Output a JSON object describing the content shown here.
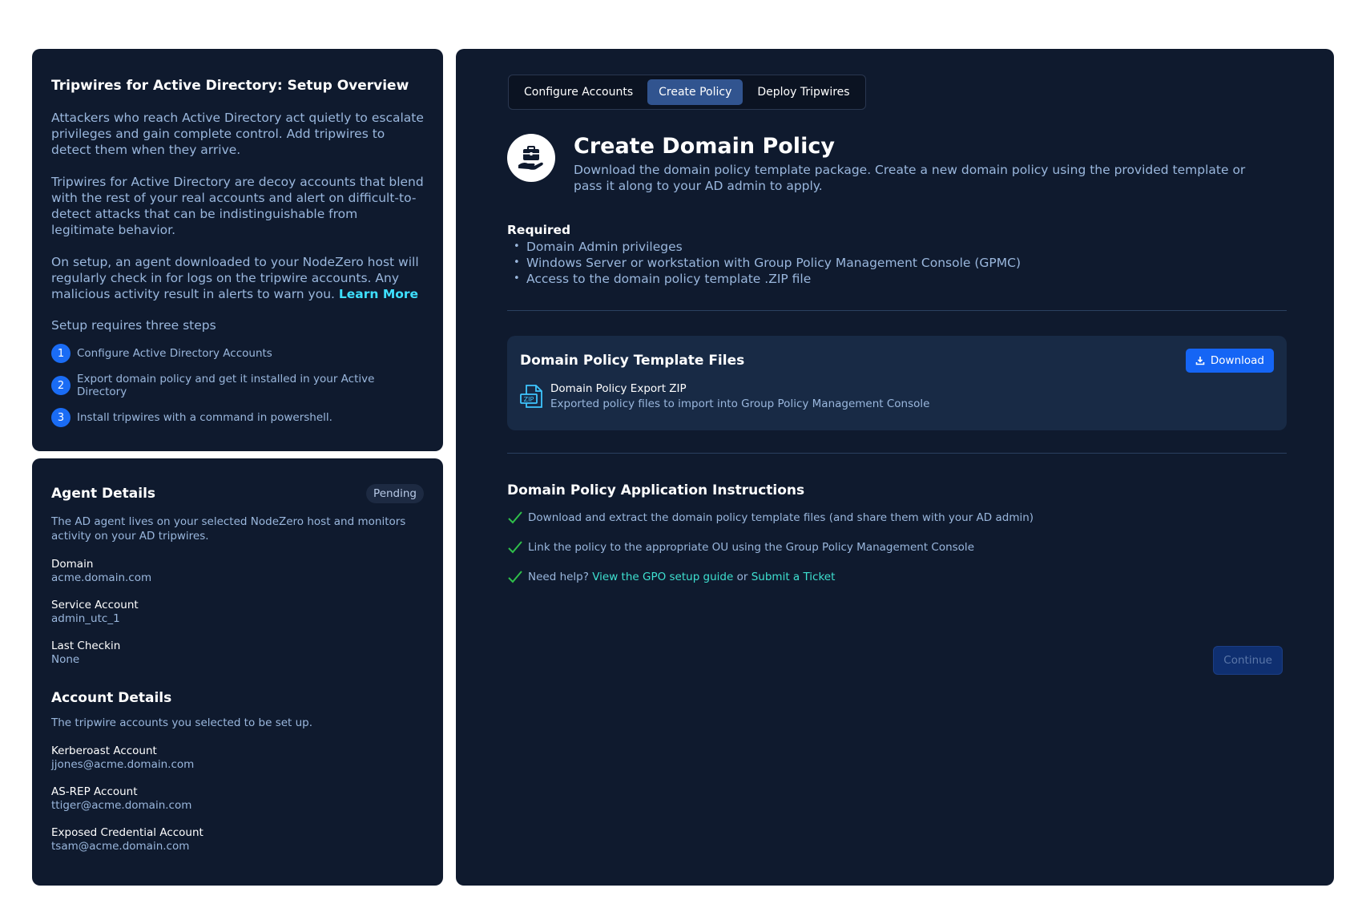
{
  "overview": {
    "title": "Tripwires for Active Directory: Setup Overview",
    "para1": "Attackers who reach Active Directory act quietly to escalate privileges and gain complete control. Add tripwires to detect them when they arrive.",
    "para2": "Tripwires for Active Directory are decoy accounts that blend with the rest of your real accounts and alert on difficult-to-detect attacks that can be indistinguishable from legitimate behavior.",
    "para3": "On setup, an agent downloaded to your NodeZero host will regularly check in for logs on the tripwire accounts. Any malicious activity result in alerts to warn you.",
    "learn_more": "Learn More",
    "steps_intro": "Setup requires three steps",
    "steps": [
      {
        "num": "1",
        "text": "Configure Active Directory Accounts"
      },
      {
        "num": "2",
        "text": "Export domain policy and get it installed in your Active Directory"
      },
      {
        "num": "3",
        "text": "Install tripwires with a command in powershell."
      }
    ]
  },
  "agent": {
    "title": "Agent Details",
    "status": "Pending",
    "desc": "The AD agent lives on your selected NodeZero host and monitors activity on your AD tripwires.",
    "fields": [
      {
        "label": "Domain",
        "value": "acme.domain.com"
      },
      {
        "label": "Service Account",
        "value": "admin_utc_1"
      },
      {
        "label": "Last Checkin",
        "value": "None"
      }
    ]
  },
  "accounts": {
    "title": "Account Details",
    "desc": "The tripwire accounts you selected to be set up.",
    "fields": [
      {
        "label": "Kerberoast Account",
        "value": "jjones@acme.domain.com"
      },
      {
        "label": "AS-REP Account",
        "value": "ttiger@acme.domain.com"
      },
      {
        "label": "Exposed Credential Account",
        "value": "tsam@acme.domain.com"
      }
    ]
  },
  "tabs": [
    {
      "label": "Configure Accounts",
      "active": false
    },
    {
      "label": "Create Policy",
      "active": true
    },
    {
      "label": "Deploy Tripwires",
      "active": false
    }
  ],
  "main": {
    "title": "Create Domain Policy",
    "desc": "Download the domain policy template package. Create a new domain policy using the provided template or pass it along to your AD admin to apply.",
    "required_title": "Required",
    "required": [
      "Domain Admin privileges",
      "Windows Server or workstation with Group Policy Management Console (GPMC)",
      "Access to the domain policy template .ZIP file"
    ],
    "files_title": "Domain Policy Template Files",
    "download_label": "Download",
    "file_name": "Domain Policy Export ZIP",
    "file_desc": "Exported policy files to import into Group Policy Management Console",
    "file_badge": "ZIP",
    "instr_title": "Domain Policy Application Instructions",
    "instr1": "Download and extract the domain policy template files (and share them with your AD admin)",
    "instr2": "Link the policy to the appropriate OU using the Group Policy Management Console",
    "help_prefix": "Need help?",
    "help_link1": "View the GPO setup guide",
    "help_or": "or",
    "help_link2": "Submit a Ticket",
    "continue_label": "Continue"
  },
  "colors": {
    "panel_bg": "#0f1a2e",
    "accent": "#1565f5",
    "link": "#3ee0d0",
    "muted_text": "#9ab7dd",
    "check": "#2fbf4a"
  },
  "icons": [
    "briefcase-hand-icon",
    "download-icon",
    "zip-file-icon",
    "check-icon"
  ]
}
